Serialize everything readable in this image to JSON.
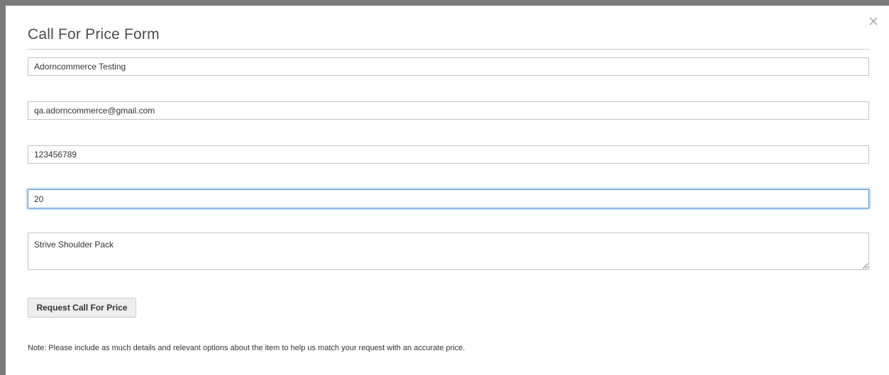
{
  "modal": {
    "title": "Call For Price Form",
    "close_icon": "close-icon"
  },
  "form": {
    "name": {
      "value": "Adorncommerce Testing",
      "placeholder": ""
    },
    "email": {
      "value": "qa.adorncommerce@gmail.com",
      "placeholder": ""
    },
    "phone": {
      "value": "123456789",
      "placeholder": ""
    },
    "quantity": {
      "value": "20",
      "placeholder": ""
    },
    "product": {
      "value": "Strive Shoulder Pack",
      "placeholder": ""
    },
    "submit_label": "Request Call For Price",
    "note": "Note: Please include as much details and relevant options about the item to help us match your request with an accurate price."
  },
  "colors": {
    "backdrop": "#7a7a7a",
    "modal_bg": "#ffffff",
    "field_border": "#c2c2c2",
    "focus_border": "#6a9fd1",
    "button_bg": "#eeeeee"
  }
}
